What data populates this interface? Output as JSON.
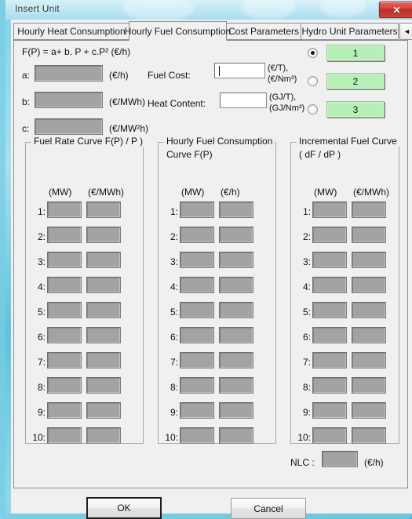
{
  "window": {
    "title": "Insert Unit",
    "close_icon": "close-icon",
    "close_label": "✕"
  },
  "tabs": {
    "items": [
      {
        "label": "Hourly Heat Consumption",
        "active": false
      },
      {
        "label": "Hourly Fuel Consumption",
        "active": true
      },
      {
        "label": "Cost Parameters",
        "active": false
      },
      {
        "label": "Hydro Unit Parameters",
        "active": false
      }
    ],
    "scroll_left_label": "◄",
    "scroll_right_label": "►"
  },
  "form": {
    "formula": "F(P)  = a+ b. P + c.P²   (€/h)",
    "coefficients": [
      {
        "label": "a:",
        "value": "",
        "unit": "(€/h)"
      },
      {
        "label": "b:",
        "value": "",
        "unit": "(€/MWh)"
      },
      {
        "label": "c:",
        "value": "",
        "unit": "(€/MW²h)"
      }
    ],
    "fuel_cost": {
      "label": "Fuel Cost:",
      "value": "",
      "unit_line1": "(€/T),",
      "unit_line2": "(€/Nm³)"
    },
    "heat_content": {
      "label": "Heat Content:",
      "value": "",
      "unit_line1": "(GJ/T),",
      "unit_line2": "(GJ/Nm³)"
    },
    "segment_selector": {
      "options": [
        {
          "radio_checked": true,
          "box_label": "1"
        },
        {
          "radio_checked": false,
          "box_label": "2"
        },
        {
          "radio_checked": false,
          "box_label": "3"
        }
      ],
      "box_color": "#b6f0b6"
    }
  },
  "groups": [
    {
      "title_line1": "Fuel Rate Curve F(P) / P )",
      "title_line2": "",
      "columns": [
        "(MW)",
        "(€/MWh)"
      ],
      "rows": [
        {
          "num": "1:",
          "values": [
            "",
            ""
          ]
        },
        {
          "num": "2:",
          "values": [
            "",
            ""
          ]
        },
        {
          "num": "3:",
          "values": [
            "",
            ""
          ]
        },
        {
          "num": "4:",
          "values": [
            "",
            ""
          ]
        },
        {
          "num": "5:",
          "values": [
            "",
            ""
          ]
        },
        {
          "num": "6:",
          "values": [
            "",
            ""
          ]
        },
        {
          "num": "7:",
          "values": [
            "",
            ""
          ]
        },
        {
          "num": "8:",
          "values": [
            "",
            ""
          ]
        },
        {
          "num": "9:",
          "values": [
            "",
            ""
          ]
        },
        {
          "num": "10:",
          "values": [
            "",
            ""
          ]
        }
      ]
    },
    {
      "title_line1": "Hourly Fuel Consumption",
      "title_line2": "Curve F(P)",
      "columns": [
        "(MW)",
        "(€/h)"
      ],
      "rows": [
        {
          "num": "1:",
          "values": [
            "",
            ""
          ]
        },
        {
          "num": "2:",
          "values": [
            "",
            ""
          ]
        },
        {
          "num": "3:",
          "values": [
            "",
            ""
          ]
        },
        {
          "num": "4:",
          "values": [
            "",
            ""
          ]
        },
        {
          "num": "5:",
          "values": [
            "",
            ""
          ]
        },
        {
          "num": "6:",
          "values": [
            "",
            ""
          ]
        },
        {
          "num": "7:",
          "values": [
            "",
            ""
          ]
        },
        {
          "num": "8:",
          "values": [
            "",
            ""
          ]
        },
        {
          "num": "9:",
          "values": [
            "",
            ""
          ]
        },
        {
          "num": "10:",
          "values": [
            "",
            ""
          ]
        }
      ]
    },
    {
      "title_line1": "Incremental Fuel Curve",
      "title_line2": "( dF / dP )",
      "columns": [
        "(MW)",
        "(€/MWh)"
      ],
      "rows": [
        {
          "num": "1:",
          "values": [
            "",
            ""
          ]
        },
        {
          "num": "2:",
          "values": [
            "",
            ""
          ]
        },
        {
          "num": "3:",
          "values": [
            "",
            ""
          ]
        },
        {
          "num": "4:",
          "values": [
            "",
            ""
          ]
        },
        {
          "num": "5:",
          "values": [
            "",
            ""
          ]
        },
        {
          "num": "6:",
          "values": [
            "",
            ""
          ]
        },
        {
          "num": "7:",
          "values": [
            "",
            ""
          ]
        },
        {
          "num": "8:",
          "values": [
            "",
            ""
          ]
        },
        {
          "num": "9:",
          "values": [
            "",
            ""
          ]
        },
        {
          "num": "10:",
          "values": [
            "",
            ""
          ]
        }
      ]
    }
  ],
  "nlc": {
    "label": "NLC :",
    "value": "",
    "unit": "(€/h)"
  },
  "footer": {
    "ok_label": "OK",
    "cancel_label": "Cancel"
  }
}
